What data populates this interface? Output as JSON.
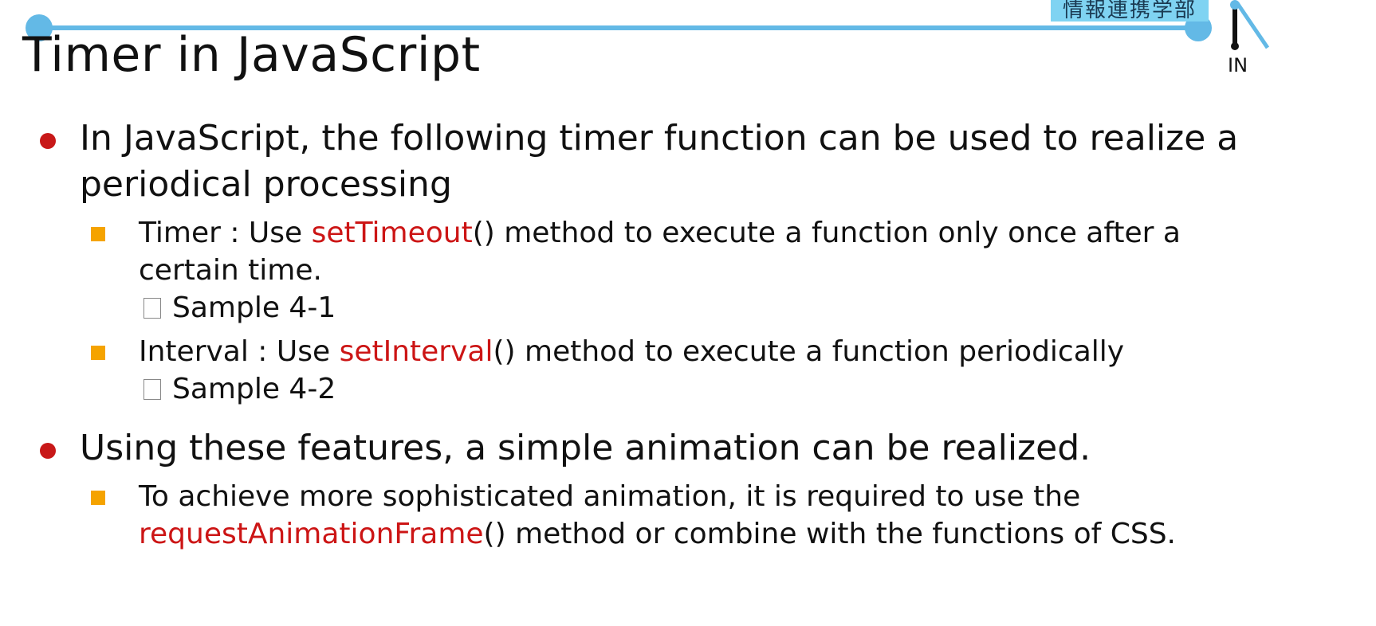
{
  "header": {
    "department_label": "情報連携学部",
    "logo_text": "IN",
    "accent_color": "#63b9e6"
  },
  "slide": {
    "title": "Timer in JavaScript",
    "bullets": [
      {
        "text": "In JavaScript, the following timer function can be used to realize a periodical processing",
        "subitems": [
          {
            "prefix": "Timer : Use ",
            "function": "setTimeout",
            "suffix": "() method to execute a function only once after a certain time.",
            "sample": "Sample 4-1"
          },
          {
            "prefix": "Interval : Use ",
            "function": "setInterval",
            "suffix": "() method to execute a function periodically",
            "sample": "Sample 4-2"
          }
        ]
      },
      {
        "text": "Using these features, a simple animation can be realized.",
        "subitems": [
          {
            "prefix": "To achieve more sophisticated animation, it is required to use the ",
            "function": "requestAnimationFrame",
            "suffix": "() method or combine with the functions of CSS."
          }
        ]
      }
    ]
  },
  "colors": {
    "bullet": "#c81818",
    "sub_bullet": "#f5a300",
    "function_highlight": "#cc1515"
  }
}
